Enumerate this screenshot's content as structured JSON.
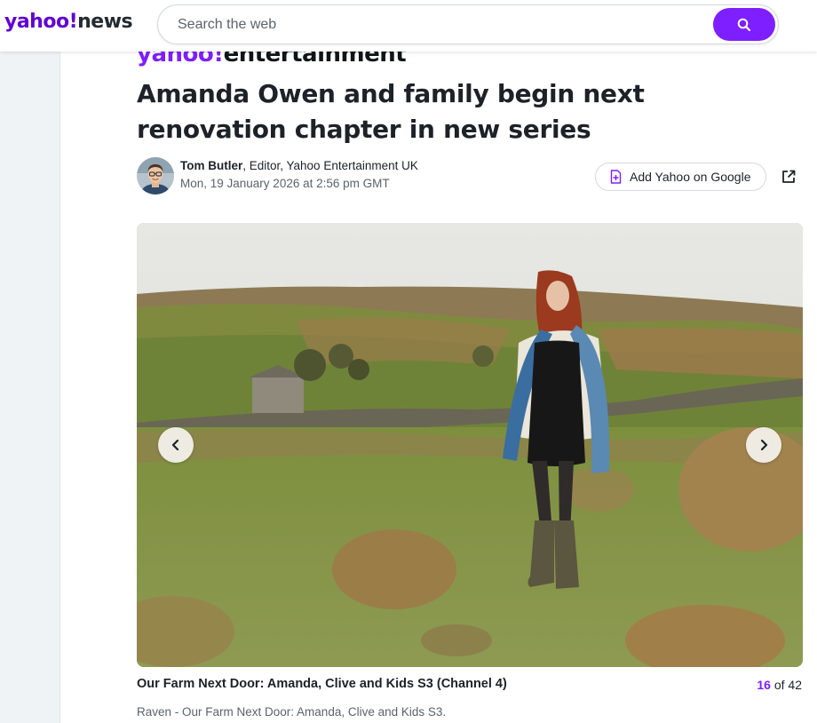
{
  "header": {
    "logo_brand": "yahoo!",
    "logo_product": "news",
    "search": {
      "placeholder": "Search the web",
      "value": ""
    },
    "search_button_icon": "search-icon"
  },
  "article": {
    "section_logo_brand": "yahoo!",
    "section_logo_product": "entertainment",
    "headline": "Amanda Owen and family begin next renovation chapter in new series",
    "author": {
      "name": "Tom Butler",
      "role": ", Editor, Yahoo Entertainment UK",
      "date": "Mon, 19 January 2026 at 2:56 pm GMT"
    },
    "actions": {
      "add_google_label": "Add Yahoo on Google",
      "add_google_icon": "add-source-icon",
      "share_icon": "share-external-icon"
    }
  },
  "gallery": {
    "caption_title": "Our Farm Next Door: Amanda, Clive and Kids S3 (Channel 4)",
    "current": "16",
    "separator": " of ",
    "total": "42",
    "caption_text": "Raven - Our Farm Next Door: Amanda, Clive and Kids S3.",
    "prev_icon": "chevron-left-icon",
    "next_icon": "chevron-right-icon"
  },
  "colors": {
    "accent": "#7e1fff",
    "brand": "#6001d2",
    "text": "#1d2228",
    "muted": "#5b636a"
  }
}
